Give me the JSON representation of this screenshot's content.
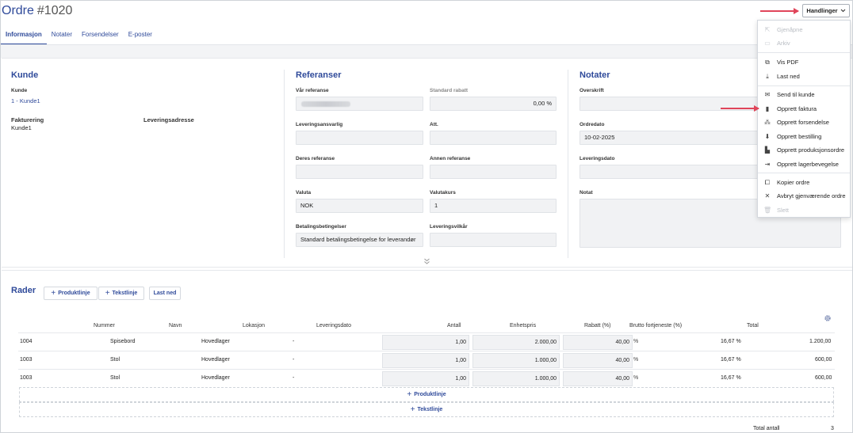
{
  "header": {
    "title": "Ordre",
    "number": "#1020",
    "actions_label": "Handlinger"
  },
  "tabs": [
    {
      "label": "Informasjon",
      "active": true
    },
    {
      "label": "Notater"
    },
    {
      "label": "Forsendelser"
    },
    {
      "label": "E-poster"
    }
  ],
  "kunde": {
    "title": "Kunde",
    "kunde_label": "Kunde",
    "kunde_value": "1 - Kunde1",
    "fakturering_label": "Fakturering",
    "fakturering_value": "Kunde1",
    "levering_label": "Leveringsadresse"
  },
  "referanser": {
    "title": "Referanser",
    "var_referanse": "Vår referanse",
    "standard_rabatt": "Standard rabatt",
    "standard_rabatt_value": "0,00 %",
    "leveringsansvarlig": "Leveringsansvarlig",
    "att": "Att.",
    "deres_referanse": "Deres referanse",
    "annen_referanse": "Annen referanse",
    "valuta": "Valuta",
    "valuta_value": "NOK",
    "valutakurs": "Valutakurs",
    "valutakurs_value": "1",
    "betalingsbetingelser": "Betalingsbetingelser",
    "betalingsbetingelser_value": "Standard betalingsbetingelse for leverandør",
    "leveringsvilkar": "Leveringsvilkår"
  },
  "notater": {
    "title": "Notater",
    "overskrift": "Overskrift",
    "ordredato": "Ordredato",
    "ordredato_value": "10-02-2025",
    "leveringsdato": "Leveringsdato",
    "notat": "Notat"
  },
  "rader": {
    "title": "Rader",
    "btn_produktlinje": "Produktlinje",
    "btn_tekstlinje": "Tekstlinje",
    "btn_lastned": "Last ned",
    "columns": [
      "Nummer",
      "Navn",
      "Lokasjon",
      "Leveringsdato",
      "Antall",
      "Enhetspris",
      "Rabatt (%)",
      "Brutto fortjeneste (%)",
      "Total"
    ],
    "rows": [
      {
        "nummer": "1004",
        "navn": "Spisebord",
        "lokasjon": "Hovedlager",
        "leveringsdato": "-",
        "antall": "1,00",
        "enhetspris": "2.000,00",
        "rabatt": "40,00",
        "brutto": "16,67 %",
        "total": "1.200,00"
      },
      {
        "nummer": "1003",
        "navn": "Stol",
        "lokasjon": "Hovedlager",
        "leveringsdato": "-",
        "antall": "1,00",
        "enhetspris": "1.000,00",
        "rabatt": "40,00",
        "brutto": "16,67 %",
        "total": "600,00"
      },
      {
        "nummer": "1003",
        "navn": "Stol",
        "lokasjon": "Hovedlager",
        "leveringsdato": "-",
        "antall": "1,00",
        "enhetspris": "1.000,00",
        "rabatt": "40,00",
        "brutto": "16,67 %",
        "total": "600,00"
      }
    ],
    "pct_sign": "%",
    "add_produktlinje": "Produktlinje",
    "add_tekstlinje": "Tekstlinje",
    "total_antall_label": "Total antall",
    "total_antall_value": "3"
  },
  "menu": {
    "items": [
      {
        "label": "Gjenåpne",
        "icon": "reopen-icon",
        "disabled": true
      },
      {
        "label": "Arkiv",
        "icon": "archive-icon",
        "disabled": true
      },
      {
        "label": "Vis PDF",
        "icon": "view-pdf-icon"
      },
      {
        "label": "Last ned",
        "icon": "download-icon"
      },
      {
        "label": "Send til kunde",
        "icon": "send-icon"
      },
      {
        "label": "Opprett faktura",
        "icon": "invoice-icon"
      },
      {
        "label": "Opprett forsendelse",
        "icon": "shipment-icon"
      },
      {
        "label": "Opprett bestilling",
        "icon": "order-icon"
      },
      {
        "label": "Opprett produksjonsordre",
        "icon": "production-icon"
      },
      {
        "label": "Opprett lagerbevegelse",
        "icon": "stock-movement-icon"
      },
      {
        "label": "Kopier ordre",
        "icon": "copy-icon"
      },
      {
        "label": "Avbryt gjenværende ordre",
        "icon": "cancel-icon"
      },
      {
        "label": "Slett",
        "icon": "trash-icon",
        "disabled": true
      }
    ]
  },
  "colors": {
    "accent": "#2f4a9a",
    "annotation_arrow": "#e0455a"
  }
}
